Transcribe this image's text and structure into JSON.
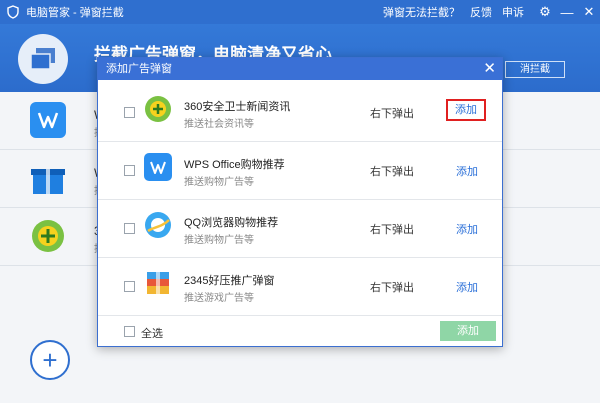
{
  "window": {
    "title": "电脑管家 - 弹窗拦截",
    "links": [
      "弹窗无法拦截？",
      "反馈",
      "申诉"
    ]
  },
  "banner": {
    "headline": "拦截广告弹窗，电脑清净又省心",
    "unblock_label": "消拦截"
  },
  "background_list": {
    "items": [
      {
        "name": "W",
        "desc": "推"
      },
      {
        "name": "W",
        "desc": "推"
      },
      {
        "name": "3",
        "desc": "推"
      }
    ]
  },
  "dialog": {
    "title": "添加广告弹窗",
    "rows": [
      {
        "name": "360安全卫士新闻资讯",
        "desc": "推送社会资讯等",
        "position": "右下弹出",
        "action": "添加",
        "icon": "360-safe-icon"
      },
      {
        "name": "WPS Office购物推荐",
        "desc": "推送购物广告等",
        "position": "右下弹出",
        "action": "添加",
        "icon": "wps-office-icon"
      },
      {
        "name": "QQ浏览器购物推荐",
        "desc": "推送购物广告等",
        "position": "右下弹出",
        "action": "添加",
        "icon": "qq-browser-icon"
      },
      {
        "name": "2345好压推广弹窗",
        "desc": "推送游戏广告等",
        "position": "右下弹出",
        "action": "添加",
        "icon": "haozip-icon"
      }
    ],
    "select_all_label": "全选",
    "add_button_label": "添加"
  },
  "colors": {
    "brand_blue": "#2f6fcf",
    "link_blue": "#2a6fd8",
    "highlight_red": "#e02020",
    "add_button_green": "#8fd6a6"
  }
}
